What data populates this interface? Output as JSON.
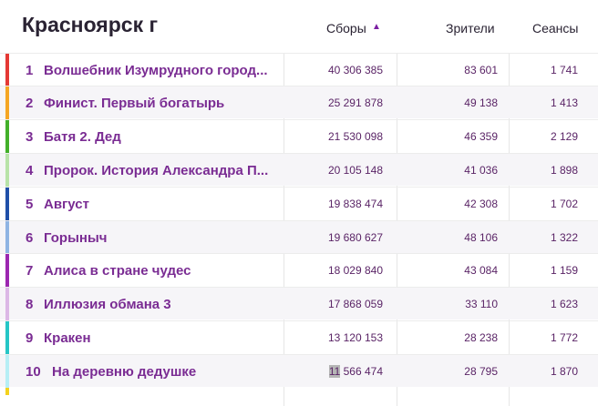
{
  "title": "Красноярск г",
  "columns": {
    "sbory": "Сборы",
    "sort_icon": "sort-ascending-icon",
    "zriteli": "Зрители",
    "seansy": "Сеансы"
  },
  "rows": [
    {
      "rank": "1",
      "title": "Волшебник Изумрудного город...",
      "sbory": "40 306 385",
      "zriteli": "83 601",
      "seansy": "1 741",
      "color": "#e53935"
    },
    {
      "rank": "2",
      "title": "Финист. Первый богатырь",
      "sbory": "25 291 878",
      "zriteli": "49 138",
      "seansy": "1 413",
      "color": "#f5a623"
    },
    {
      "rank": "3",
      "title": "Батя 2. Дед",
      "sbory": "21 530 098",
      "zriteli": "46 359",
      "seansy": "2 129",
      "color": "#43b02a"
    },
    {
      "rank": "4",
      "title": "Пророк. История Александра П...",
      "sbory": "20 105 148",
      "zriteli": "41 036",
      "seansy": "1 898",
      "color": "#b8e3a8"
    },
    {
      "rank": "5",
      "title": "Август",
      "sbory": "19 838 474",
      "zriteli": "42 308",
      "seansy": "1 702",
      "color": "#1f4fa8"
    },
    {
      "rank": "6",
      "title": "Горыныч",
      "sbory": "19 680 627",
      "zriteli": "48 106",
      "seansy": "1 322",
      "color": "#8fb4e3"
    },
    {
      "rank": "7",
      "title": "Алиса в стране чудес",
      "sbory": "18 029 840",
      "zriteli": "43 084",
      "seansy": "1 159",
      "color": "#9c27b0"
    },
    {
      "rank": "8",
      "title": "Иллюзия обмана 3",
      "sbory": "17 868 059",
      "zriteli": "33 110",
      "seansy": "1 623",
      "color": "#dcb8e6"
    },
    {
      "rank": "9",
      "title": "Кракен",
      "sbory": "13 120 153",
      "zriteli": "28 238",
      "seansy": "1 772",
      "color": "#26c6c6"
    },
    {
      "rank": "10",
      "title": "На деревню дедушке",
      "sbory_hl": "11",
      "sbory_rest": " 566 474",
      "zriteli": "28 795",
      "seansy": "1 870",
      "color": "#b7eef5"
    }
  ]
}
